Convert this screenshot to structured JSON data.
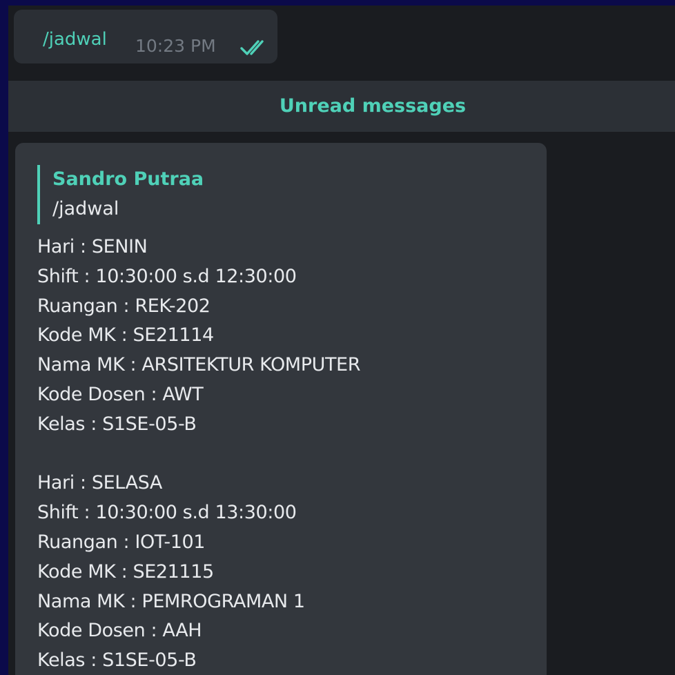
{
  "outgoing": {
    "text": "/jadwal",
    "time": "10:23 PM",
    "status_icon": "double-check-icon"
  },
  "unread_divider": {
    "label": "Unread messages"
  },
  "incoming": {
    "reply": {
      "author": "Sandro Putraa",
      "text": "/jadwal"
    },
    "schedule": [
      {
        "lines": [
          "Hari : SENIN",
          "Shift : 10:30:00 s.d 12:30:00",
          "Ruangan : REK-202",
          "Kode MK : SE21114",
          "Nama MK : ARSITEKTUR KOMPUTER",
          "Kode Dosen : AWT",
          "Kelas : S1SE-05-B"
        ]
      },
      {
        "lines": [
          "Hari : SELASA",
          "Shift : 10:30:00 s.d 13:30:00",
          "Ruangan : IOT-101",
          "Kode MK : SE21115",
          "Nama MK : PEMROGRAMAN 1",
          "Kode Dosen : AAH",
          "Kelas : S1SE-05-B"
        ]
      }
    ]
  },
  "colors": {
    "accent": "#4fd1b8",
    "chat_background": "#1a1c20",
    "bubble": "#33373d",
    "outer_border": "#0b0a4a"
  }
}
